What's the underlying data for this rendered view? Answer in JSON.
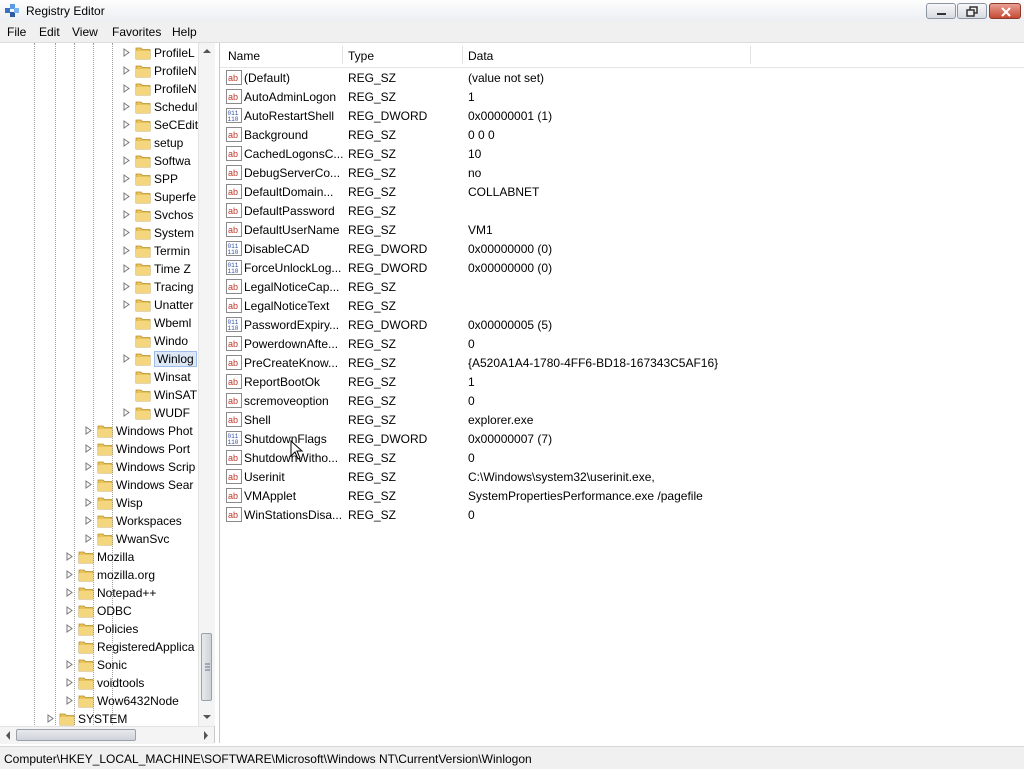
{
  "window": {
    "title": "Registry Editor"
  },
  "menu": [
    "File",
    "Edit",
    "View",
    "Favorites",
    "Help"
  ],
  "tree": [
    {
      "label": "ProfileL",
      "depth": 3,
      "exp": true
    },
    {
      "label": "ProfileN",
      "depth": 3,
      "exp": true
    },
    {
      "label": "ProfileN",
      "depth": 3,
      "exp": true
    },
    {
      "label": "Schedule",
      "depth": 3,
      "exp": true
    },
    {
      "label": "SeCEdit",
      "depth": 3,
      "exp": true
    },
    {
      "label": "setup",
      "depth": 3,
      "exp": true
    },
    {
      "label": "Softwa",
      "depth": 3,
      "exp": true
    },
    {
      "label": "SPP",
      "depth": 3,
      "exp": true
    },
    {
      "label": "Superfe",
      "depth": 3,
      "exp": true
    },
    {
      "label": "Svchos",
      "depth": 3,
      "exp": true
    },
    {
      "label": "System",
      "depth": 3,
      "exp": true
    },
    {
      "label": "Termin",
      "depth": 3,
      "exp": true
    },
    {
      "label": "Time Z",
      "depth": 3,
      "exp": true
    },
    {
      "label": "Tracing",
      "depth": 3,
      "exp": true
    },
    {
      "label": "Unatter",
      "depth": 3,
      "exp": true
    },
    {
      "label": "Wbeml",
      "depth": 3,
      "exp": false
    },
    {
      "label": "Windo",
      "depth": 3,
      "exp": false
    },
    {
      "label": "Winlog",
      "depth": 3,
      "exp": true,
      "selected": true
    },
    {
      "label": "Winsat",
      "depth": 3,
      "exp": false
    },
    {
      "label": "WinSAT",
      "depth": 3,
      "exp": false
    },
    {
      "label": "WUDF",
      "depth": 3,
      "exp": true
    },
    {
      "label": "Windows Phot",
      "depth": 2,
      "exp": true
    },
    {
      "label": "Windows Port",
      "depth": 2,
      "exp": true
    },
    {
      "label": "Windows Scrip",
      "depth": 2,
      "exp": true
    },
    {
      "label": "Windows Sear",
      "depth": 2,
      "exp": true
    },
    {
      "label": "Wisp",
      "depth": 2,
      "exp": true
    },
    {
      "label": "Workspaces",
      "depth": 2,
      "exp": true
    },
    {
      "label": "WwanSvc",
      "depth": 2,
      "exp": true
    },
    {
      "label": "Mozilla",
      "depth": 1,
      "exp": true
    },
    {
      "label": "mozilla.org",
      "depth": 1,
      "exp": true
    },
    {
      "label": "Notepad++",
      "depth": 1,
      "exp": true
    },
    {
      "label": "ODBC",
      "depth": 1,
      "exp": true
    },
    {
      "label": "Policies",
      "depth": 1,
      "exp": true
    },
    {
      "label": "RegisteredApplica",
      "depth": 1,
      "exp": false
    },
    {
      "label": "Sonic",
      "depth": 1,
      "exp": true
    },
    {
      "label": "voidtools",
      "depth": 1,
      "exp": true
    },
    {
      "label": "Wow6432Node",
      "depth": 1,
      "exp": true
    },
    {
      "label": "SYSTEM",
      "depth": 0,
      "exp": true
    }
  ],
  "columns": {
    "name": "Name",
    "type": "Type",
    "data": "Data"
  },
  "values": [
    {
      "name": "(Default)",
      "type": "REG_SZ",
      "data": "(value not set)",
      "icon": "string-value-icon"
    },
    {
      "name": "AutoAdminLogon",
      "type": "REG_SZ",
      "data": "1",
      "icon": "string-value-icon"
    },
    {
      "name": "AutoRestartShell",
      "type": "REG_DWORD",
      "data": "0x00000001 (1)",
      "icon": "binary-value-icon"
    },
    {
      "name": "Background",
      "type": "REG_SZ",
      "data": "0 0 0",
      "icon": "string-value-icon"
    },
    {
      "name": "CachedLogonsC...",
      "type": "REG_SZ",
      "data": "10",
      "icon": "string-value-icon"
    },
    {
      "name": "DebugServerCo...",
      "type": "REG_SZ",
      "data": "no",
      "icon": "string-value-icon"
    },
    {
      "name": "DefaultDomain...",
      "type": "REG_SZ",
      "data": "COLLABNET",
      "icon": "string-value-icon"
    },
    {
      "name": "DefaultPassword",
      "type": "REG_SZ",
      "data": "",
      "icon": "string-value-icon"
    },
    {
      "name": "DefaultUserName",
      "type": "REG_SZ",
      "data": "VM1",
      "icon": "string-value-icon"
    },
    {
      "name": "DisableCAD",
      "type": "REG_DWORD",
      "data": "0x00000000 (0)",
      "icon": "binary-value-icon"
    },
    {
      "name": "ForceUnlockLog...",
      "type": "REG_DWORD",
      "data": "0x00000000 (0)",
      "icon": "binary-value-icon"
    },
    {
      "name": "LegalNoticeCap...",
      "type": "REG_SZ",
      "data": "",
      "icon": "string-value-icon"
    },
    {
      "name": "LegalNoticeText",
      "type": "REG_SZ",
      "data": "",
      "icon": "string-value-icon"
    },
    {
      "name": "PasswordExpiry...",
      "type": "REG_DWORD",
      "data": "0x00000005 (5)",
      "icon": "binary-value-icon"
    },
    {
      "name": "PowerdownAfte...",
      "type": "REG_SZ",
      "data": "0",
      "icon": "string-value-icon"
    },
    {
      "name": "PreCreateKnow...",
      "type": "REG_SZ",
      "data": "{A520A1A4-1780-4FF6-BD18-167343C5AF16}",
      "icon": "string-value-icon"
    },
    {
      "name": "ReportBootOk",
      "type": "REG_SZ",
      "data": "1",
      "icon": "string-value-icon"
    },
    {
      "name": "scremoveoption",
      "type": "REG_SZ",
      "data": "0",
      "icon": "string-value-icon"
    },
    {
      "name": "Shell",
      "type": "REG_SZ",
      "data": "explorer.exe",
      "icon": "string-value-icon"
    },
    {
      "name": "ShutdownFlags",
      "type": "REG_DWORD",
      "data": "0x00000007 (7)",
      "icon": "binary-value-icon"
    },
    {
      "name": "ShutdownWitho...",
      "type": "REG_SZ",
      "data": "0",
      "icon": "string-value-icon"
    },
    {
      "name": "Userinit",
      "type": "REG_SZ",
      "data": "C:\\Windows\\system32\\userinit.exe,",
      "icon": "string-value-icon"
    },
    {
      "name": "VMApplet",
      "type": "REG_SZ",
      "data": "SystemPropertiesPerformance.exe /pagefile",
      "icon": "string-value-icon"
    },
    {
      "name": "WinStationsDisa...",
      "type": "REG_SZ",
      "data": "0",
      "icon": "string-value-icon"
    }
  ],
  "status": {
    "path": "Computer\\HKEY_LOCAL_MACHINE\\SOFTWARE\\Microsoft\\Windows NT\\CurrentVersion\\Winlogon"
  },
  "colors": {
    "folder": "#e8c25a",
    "selection": "#dde8f6",
    "stringIcon": "#c0392b",
    "binaryIcon": "#2c4f9e"
  }
}
